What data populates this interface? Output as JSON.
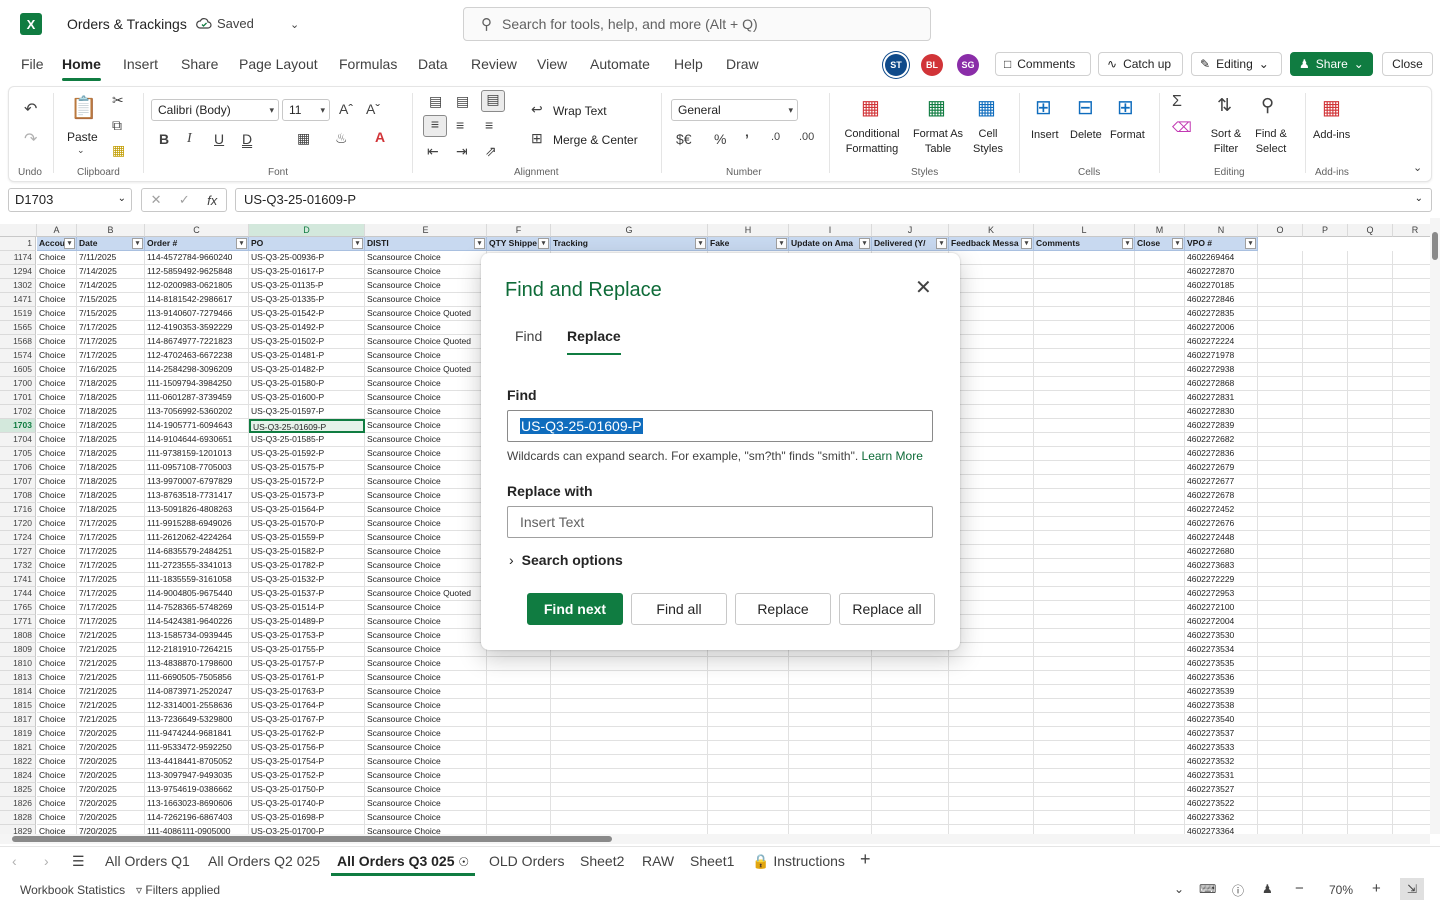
{
  "title_bar": {
    "app_logo": "X",
    "doc_title": "Orders & Trackings",
    "saved_label": "Saved",
    "search_placeholder": "Search for tools, help, and more (Alt + Q)"
  },
  "menu": {
    "tabs": [
      "File",
      "Home",
      "Insert",
      "Share",
      "Page Layout",
      "Formulas",
      "Data",
      "Review",
      "View",
      "Automate",
      "Help",
      "Draw"
    ],
    "active": "Home",
    "avatars": [
      {
        "initials": "ST",
        "color": "#0f4a8a"
      },
      {
        "initials": "BL",
        "color": "#d13438"
      },
      {
        "initials": "SG",
        "color": "#8a2da8"
      }
    ],
    "comments_label": "Comments",
    "catchup_label": "Catch up",
    "editing_label": "Editing",
    "share_label": "Share",
    "close_label": "Close"
  },
  "ribbon": {
    "groups": {
      "undo": "Undo",
      "clipboard": "Clipboard",
      "font": "Font",
      "alignment": "Alignment",
      "number": "Number",
      "styles": "Styles",
      "cells": "Cells",
      "editing": "Editing",
      "addins": "Add-ins"
    },
    "paste_label": "Paste",
    "font_name": "Calibri (Body)",
    "font_size": "11",
    "wrap_text": "Wrap Text",
    "merge_center": "Merge & Center",
    "number_format": "General",
    "conditional_formatting": [
      "Conditional",
      "Formatting"
    ],
    "format_as_table": [
      "Format As",
      "Table"
    ],
    "cell_styles": [
      "Cell",
      "Styles"
    ],
    "insert": "Insert",
    "delete": "Delete",
    "format": "Format",
    "sort_filter": [
      "Sort &",
      "Filter"
    ],
    "find_select": [
      "Find &",
      "Select"
    ],
    "addins": "Add-ins"
  },
  "formula_bar": {
    "name_box": "D1703",
    "fx": "fx",
    "formula": "US-Q3-25-01609-P"
  },
  "grid": {
    "columns": [
      {
        "letter": "A",
        "header": "Accou",
        "w": 40
      },
      {
        "letter": "B",
        "header": "Date",
        "w": 68
      },
      {
        "letter": "C",
        "header": "Order #",
        "w": 104
      },
      {
        "letter": "D",
        "header": "PO",
        "w": 116
      },
      {
        "letter": "E",
        "header": "DISTI",
        "w": 122
      },
      {
        "letter": "F",
        "header": "QTY Shippe",
        "w": 64
      },
      {
        "letter": "G",
        "header": "Tracking",
        "w": 157
      },
      {
        "letter": "H",
        "header": "Fake",
        "w": 81
      },
      {
        "letter": "I",
        "header": "Update on Ama",
        "w": 83
      },
      {
        "letter": "J",
        "header": "Delivered (Y/",
        "w": 77
      },
      {
        "letter": "K",
        "header": "Feedback Messa",
        "w": 85
      },
      {
        "letter": "L",
        "header": "Comments",
        "w": 101
      },
      {
        "letter": "M",
        "header": "Close",
        "w": 50
      },
      {
        "letter": "N",
        "header": "VPO #",
        "w": 73
      },
      {
        "letter": "O",
        "header": "",
        "w": 45
      },
      {
        "letter": "P",
        "header": "",
        "w": 45
      },
      {
        "letter": "Q",
        "header": "",
        "w": 45
      },
      {
        "letter": "R",
        "header": "",
        "w": 45
      }
    ],
    "selected_row": "1703",
    "rows": [
      [
        "1174",
        "Choice",
        "7/11/2025",
        "114-4572784-9660240",
        "US-Q3-25-00936-P",
        "Scansource Choice",
        "4602269464"
      ],
      [
        "1294",
        "Choice",
        "7/14/2025",
        "112-5859492-9625848",
        "US-Q3-25-01617-P",
        "Scansource Choice",
        "4602272870"
      ],
      [
        "1302",
        "Choice",
        "7/14/2025",
        "112-0200983-0621805",
        "US-Q3-25-01135-P",
        "Scansource Choice",
        "4602270185"
      ],
      [
        "1471",
        "Choice",
        "7/15/2025",
        "114-8181542-2986617",
        "US-Q3-25-01335-P",
        "Scansource Choice",
        "4602272846"
      ],
      [
        "1519",
        "Choice",
        "7/15/2025",
        "113-9140607-7279466",
        "US-Q3-25-01542-P",
        "Scansource Choice Quoted",
        "4602272835"
      ],
      [
        "1565",
        "Choice",
        "7/17/2025",
        "112-4190353-3592229",
        "US-Q3-25-01492-P",
        "Scansource Choice",
        "4602272006"
      ],
      [
        "1568",
        "Choice",
        "7/17/2025",
        "114-8674977-7221823",
        "US-Q3-25-01502-P",
        "Scansource Choice Quoted",
        "4602272224"
      ],
      [
        "1574",
        "Choice",
        "7/17/2025",
        "112-4702463-6672238",
        "US-Q3-25-01481-P",
        "Scansource Choice",
        "4602271978"
      ],
      [
        "1605",
        "Choice",
        "7/16/2025",
        "114-2584298-3096209",
        "US-Q3-25-01482-P",
        "Scansource Choice Quoted",
        "4602272938"
      ],
      [
        "1700",
        "Choice",
        "7/18/2025",
        "111-1509794-3984250",
        "US-Q3-25-01580-P",
        "Scansource Choice",
        "4602272868"
      ],
      [
        "1701",
        "Choice",
        "7/18/2025",
        "111-0601287-3739459",
        "US-Q3-25-01600-P",
        "Scansource Choice",
        "4602272831"
      ],
      [
        "1702",
        "Choice",
        "7/18/2025",
        "113-7056992-5360202",
        "US-Q3-25-01597-P",
        "Scansource Choice",
        "4602272830"
      ],
      [
        "1703",
        "Choice",
        "7/18/2025",
        "114-1905771-6094643",
        "US-Q3-25-01609-P",
        "Scansource Choice",
        "4602272839"
      ],
      [
        "1704",
        "Choice",
        "7/18/2025",
        "114-9104644-6930651",
        "US-Q3-25-01585-P",
        "Scansource Choice",
        "4602272682"
      ],
      [
        "1705",
        "Choice",
        "7/18/2025",
        "111-9738159-1201013",
        "US-Q3-25-01592-P",
        "Scansource Choice",
        "4602272836"
      ],
      [
        "1706",
        "Choice",
        "7/18/2025",
        "111-0957108-7705003",
        "US-Q3-25-01575-P",
        "Scansource Choice",
        "4602272679"
      ],
      [
        "1707",
        "Choice",
        "7/18/2025",
        "113-9970007-6797829",
        "US-Q3-25-01572-P",
        "Scansource Choice",
        "4602272677"
      ],
      [
        "1708",
        "Choice",
        "7/18/2025",
        "113-8763518-7731417",
        "US-Q3-25-01573-P",
        "Scansource Choice",
        "4602272678"
      ],
      [
        "1716",
        "Choice",
        "7/18/2025",
        "113-5091826-4808263",
        "US-Q3-25-01564-P",
        "Scansource Choice",
        "4602272452"
      ],
      [
        "1720",
        "Choice",
        "7/17/2025",
        "111-9915288-6949026",
        "US-Q3-25-01570-P",
        "Scansource Choice",
        "4602272676"
      ],
      [
        "1724",
        "Choice",
        "7/17/2025",
        "111-2612062-4224264",
        "US-Q3-25-01559-P",
        "Scansource Choice",
        "4602272448"
      ],
      [
        "1727",
        "Choice",
        "7/17/2025",
        "114-6835579-2484251",
        "US-Q3-25-01582-P",
        "Scansource Choice",
        "4602272680"
      ],
      [
        "1732",
        "Choice",
        "7/17/2025",
        "111-2723555-3341013",
        "US-Q3-25-01782-P",
        "Scansource Choice",
        "4602273683"
      ],
      [
        "1741",
        "Choice",
        "7/17/2025",
        "111-1835559-3161058",
        "US-Q3-25-01532-P",
        "Scansource Choice",
        "4602272229"
      ],
      [
        "1744",
        "Choice",
        "7/17/2025",
        "114-9004805-9675440",
        "US-Q3-25-01537-P",
        "Scansource Choice Quoted",
        "4602272953"
      ],
      [
        "1765",
        "Choice",
        "7/17/2025",
        "114-7528365-5748269",
        "US-Q3-25-01514-P",
        "Scansource Choice",
        "4602272100"
      ],
      [
        "1771",
        "Choice",
        "7/17/2025",
        "114-5424381-9640226",
        "US-Q3-25-01489-P",
        "Scansource Choice",
        "4602272004"
      ],
      [
        "1808",
        "Choice",
        "7/21/2025",
        "113-1585734-0939445",
        "US-Q3-25-01753-P",
        "Scansource Choice",
        "4602273530"
      ],
      [
        "1809",
        "Choice",
        "7/21/2025",
        "112-2181910-7264215",
        "US-Q3-25-01755-P",
        "Scansource Choice",
        "4602273534"
      ],
      [
        "1810",
        "Choice",
        "7/21/2025",
        "113-4838870-1798600",
        "US-Q3-25-01757-P",
        "Scansource Choice",
        "4602273535"
      ],
      [
        "1813",
        "Choice",
        "7/21/2025",
        "111-6690505-7505856",
        "US-Q3-25-01761-P",
        "Scansource Choice",
        "4602273536"
      ],
      [
        "1814",
        "Choice",
        "7/21/2025",
        "114-0873971-2520247",
        "US-Q3-25-01763-P",
        "Scansource Choice",
        "4602273539"
      ],
      [
        "1815",
        "Choice",
        "7/21/2025",
        "112-3314001-2558636",
        "US-Q3-25-01764-P",
        "Scansource Choice",
        "4602273538"
      ],
      [
        "1817",
        "Choice",
        "7/21/2025",
        "113-7236649-5329800",
        "US-Q3-25-01767-P",
        "Scansource Choice",
        "4602273540"
      ],
      [
        "1819",
        "Choice",
        "7/20/2025",
        "111-9474244-9681841",
        "US-Q3-25-01762-P",
        "Scansource Choice",
        "4602273537"
      ],
      [
        "1821",
        "Choice",
        "7/20/2025",
        "111-9533472-9592250",
        "US-Q3-25-01756-P",
        "Scansource Choice",
        "4602273533"
      ],
      [
        "1822",
        "Choice",
        "7/20/2025",
        "113-4418441-8705052",
        "US-Q3-25-01754-P",
        "Scansource Choice",
        "4602273532"
      ],
      [
        "1824",
        "Choice",
        "7/20/2025",
        "113-3097947-9493035",
        "US-Q3-25-01752-P",
        "Scansource Choice",
        "4602273531"
      ],
      [
        "1825",
        "Choice",
        "7/20/2025",
        "113-9754619-0386662",
        "US-Q3-25-01750-P",
        "Scansource Choice",
        "4602273527"
      ],
      [
        "1826",
        "Choice",
        "7/20/2025",
        "113-1663023-8690606",
        "US-Q3-25-01740-P",
        "Scansource Choice",
        "4602273522"
      ],
      [
        "1828",
        "Choice",
        "7/20/2025",
        "114-7262196-6867403",
        "US-Q3-25-01698-P",
        "Scansource Choice",
        "4602273362"
      ],
      [
        "1829",
        "Choice",
        "7/20/2025",
        "111-4086111-0905000",
        "US-Q3-25-01700-P",
        "Scansource Choice",
        "4602273364"
      ]
    ]
  },
  "sheet_tabs": {
    "tabs": [
      "All Orders Q1",
      "All Orders Q2 025",
      "All Orders Q3 025",
      "OLD Orders",
      "Sheet2",
      "RAW",
      "Sheet1",
      "Instructions"
    ],
    "active": "All Orders Q3 025"
  },
  "status_bar": {
    "workbook_statistics": "Workbook Statistics",
    "filters_applied": "Filters applied",
    "zoom": "70%"
  },
  "dialog": {
    "title": "Find and Replace",
    "tabs": [
      "Find",
      "Replace"
    ],
    "active_tab": "Replace",
    "find_label": "Find",
    "find_value": "US-Q3-25-01609-P",
    "hint": "Wildcards can expand search. For example, \"sm?th\" finds \"smith\".",
    "learn_more": "Learn More",
    "replace_label": "Replace with",
    "replace_placeholder": "Insert Text",
    "search_options": "Search options",
    "buttons": {
      "find_next": "Find next",
      "find_all": "Find all",
      "replace": "Replace",
      "replace_all": "Replace all"
    }
  }
}
